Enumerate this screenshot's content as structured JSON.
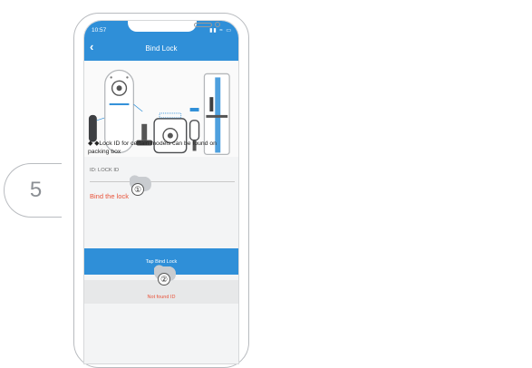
{
  "step": {
    "number": "5"
  },
  "status_bar": {
    "time": "10:57",
    "icons": "▮▮ ≈ ▭"
  },
  "header": {
    "title": "Bind Lock",
    "back_icon": "chevron-left-icon"
  },
  "content": {
    "note": "◆ ◆Lock ID for certain models can be found on packing box",
    "field_label": "ID: LOCK ID",
    "bind_link": "Bind the lock"
  },
  "buttons": {
    "primary": "Tap Bind Lock",
    "secondary": "Not found ID"
  },
  "markers": [
    "①",
    "②"
  ],
  "colors": {
    "accent": "#2f8fd8",
    "alert": "#e8533a"
  }
}
